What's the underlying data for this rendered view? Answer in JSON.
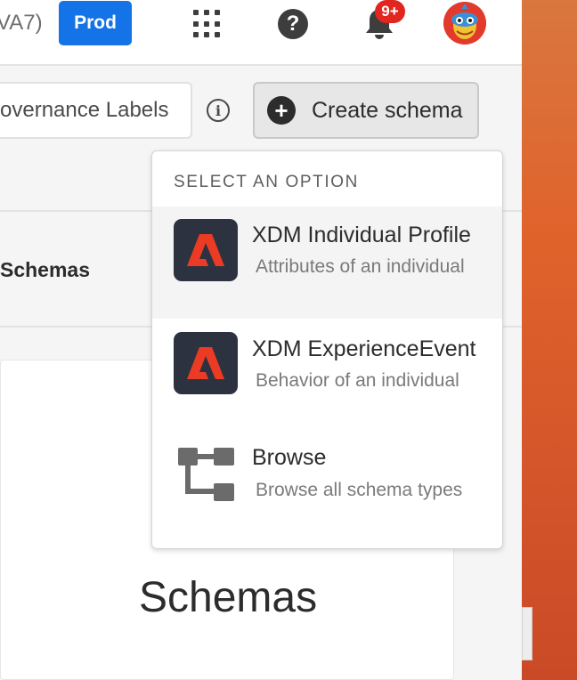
{
  "topbar": {
    "org_fragment": "VA7)",
    "environment": "Prod",
    "notification_count": "9+",
    "icons": [
      "apps-grid-icon",
      "help-icon",
      "bell-icon",
      "user-avatar"
    ]
  },
  "toolbar": {
    "governance_label": "overnance Labels",
    "create_label": "Create schema"
  },
  "section": {
    "title": "Schemas"
  },
  "main": {
    "empty_state_title": "Schemas"
  },
  "create_menu": {
    "header": "SELECT AN OPTION",
    "items": [
      {
        "title": "XDM Individual Profile",
        "description": "Attributes of an individual",
        "icon": "adobe-logo-icon",
        "highlighted": true
      },
      {
        "title": "XDM ExperienceEvent",
        "description": "Behavior of an individual",
        "icon": "adobe-logo-icon",
        "highlighted": false
      },
      {
        "title": "Browse",
        "description": "Browse all schema types",
        "icon": "tree-structure-icon",
        "highlighted": false
      }
    ]
  },
  "colors": {
    "brand_blue": "#1473e6",
    "notification_red": "#e0261f",
    "adobe_red": "#eb3b24",
    "logo_bg": "#2d3240"
  }
}
